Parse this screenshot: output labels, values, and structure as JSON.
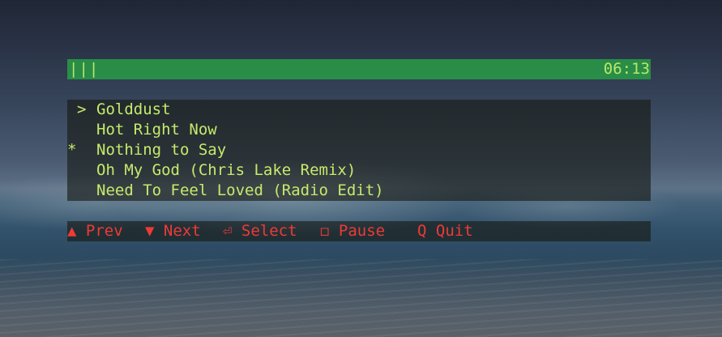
{
  "status": {
    "progress": "|||",
    "time": "06:13"
  },
  "tracks": [
    {
      "marker": ">",
      "title": "Golddust"
    },
    {
      "marker": "",
      "title": "Hot Right Now"
    },
    {
      "marker": "*",
      "title": "Nothing to Say"
    },
    {
      "marker": "",
      "title": "Oh My God (Chris Lake Remix)"
    },
    {
      "marker": "",
      "title": "Need To Feel Loved (Radio Edit)"
    }
  ],
  "help": {
    "prev": "▲ Prev",
    "next": "▼ Next",
    "select": "⏎ Select",
    "pause": "◻ Pause",
    "quit": "Q Quit"
  },
  "colors": {
    "status_bar_bg": "#28a046",
    "status_text": "#b8e86a",
    "track_text": "#c6ea6c",
    "help_text": "#ee3a36"
  }
}
